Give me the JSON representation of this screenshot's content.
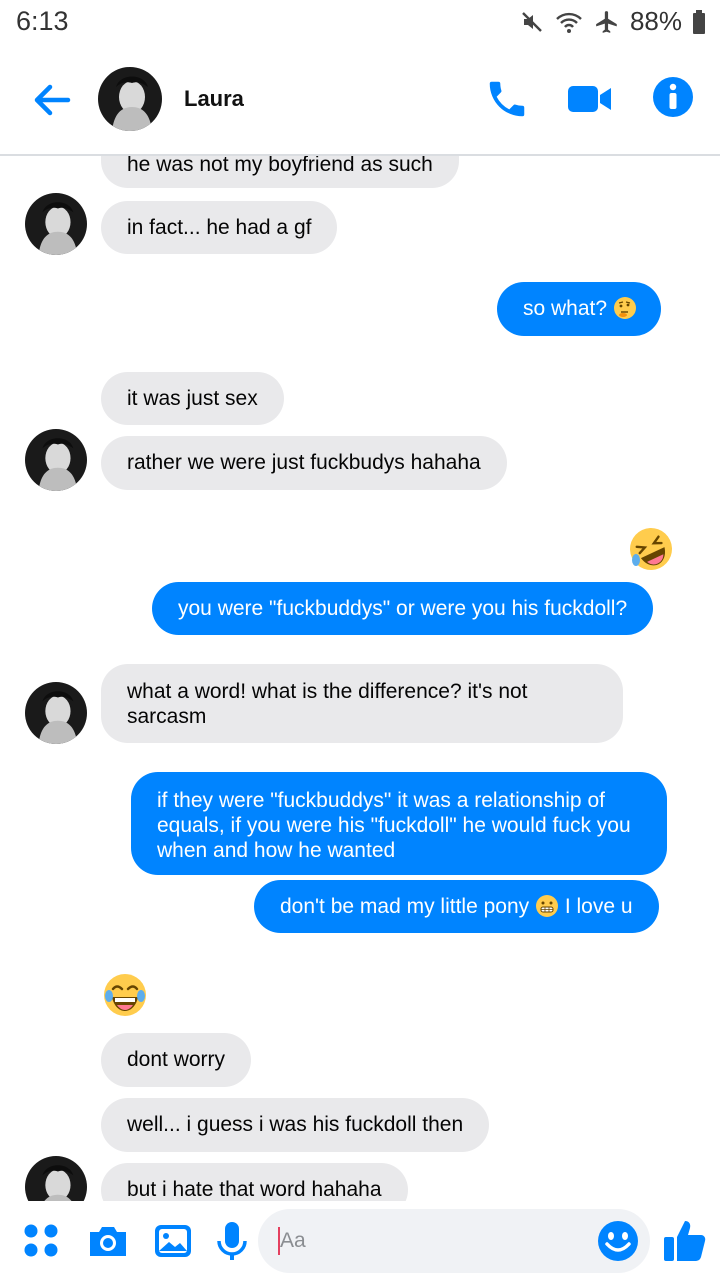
{
  "status_bar": {
    "time": "6:13",
    "battery": "88%"
  },
  "header": {
    "contact_name": "Laura"
  },
  "messages": [
    {
      "side": "in",
      "text": "he was not my boyfriend as such"
    },
    {
      "side": "in",
      "text": "in fact... he had a gf"
    },
    {
      "side": "out",
      "text": "so what?"
    },
    {
      "side": "in",
      "text": "it was just sex"
    },
    {
      "side": "in",
      "text": "rather we were just fuckbudys hahaha"
    },
    {
      "side": "out",
      "emoji": "rolling-on-floor-laughing"
    },
    {
      "side": "out",
      "text": "you were \"fuckbuddys\" or were you his fuckdoll?"
    },
    {
      "side": "in",
      "text": "what a word! what is the difference? it's not sarcasm"
    },
    {
      "side": "out",
      "text": "if they were \"fuckbuddys\" it was a relationship of equals, if you were his \"fuckdoll\" he would fuck you when and how he wanted"
    },
    {
      "side": "out",
      "text_before": "don't be mad my little pony",
      "text_after": "I love u"
    },
    {
      "side": "in",
      "emoji": "tears-of-joy"
    },
    {
      "side": "in",
      "text": "dont worry"
    },
    {
      "side": "in",
      "text": "well... i guess i was his fuckdoll then"
    },
    {
      "side": "in",
      "text": "but i hate that word hahaha"
    }
  ],
  "composer": {
    "placeholder": "Aa"
  },
  "colors": {
    "accent": "#0084ff",
    "incoming_bubble": "#e9e9eb",
    "outgoing_bubble": "#0084ff"
  },
  "icons": [
    "back-arrow-icon",
    "phone-icon",
    "video-icon",
    "info-icon",
    "menu-dots-icon",
    "camera-icon",
    "gallery-icon",
    "microphone-icon",
    "emoji-icon",
    "thumbs-up-icon"
  ]
}
